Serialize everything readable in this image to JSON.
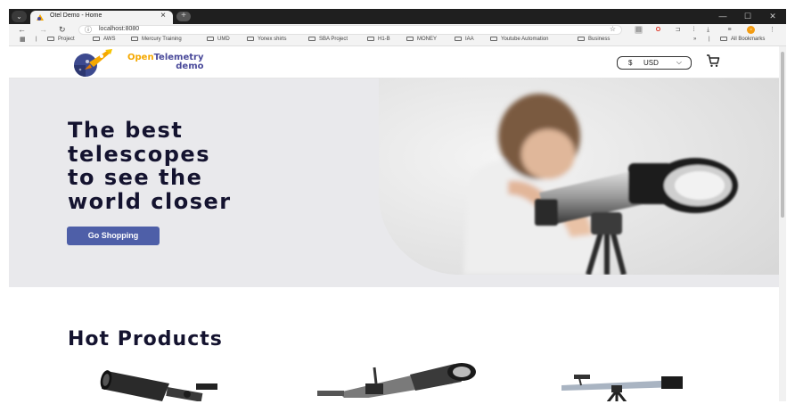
{
  "browser": {
    "tab_title": "Otel Demo - Home",
    "tab_close": "×",
    "new_tab": "+",
    "url": "localhost:8080",
    "window_controls": [
      "—",
      "☐",
      "✕"
    ],
    "bookmarks": [
      "Project",
      "AWS",
      "Mercury Training",
      "UMD",
      "Yonex shirts",
      "SBA Project",
      "H1-B",
      "MONEY",
      "IAA",
      "Youtube Automation",
      "Business"
    ],
    "all_bookmarks": "All Bookmarks",
    "overflow": "»"
  },
  "header": {
    "brand_open": "Open",
    "brand_telemetry": "Telemetry",
    "brand_demo": "demo",
    "currency_symbol": "$",
    "currency_code": "USD"
  },
  "hero": {
    "title_lines": [
      "The best",
      "telescopes",
      "to see the",
      "world closer"
    ],
    "button": "Go Shopping"
  },
  "products": {
    "section_title": "Hot Products"
  },
  "colors": {
    "accent": "#4e5fa8",
    "hero_bg": "#e9e9ec",
    "heading": "#14132f",
    "brand_orange": "#f5a800"
  }
}
